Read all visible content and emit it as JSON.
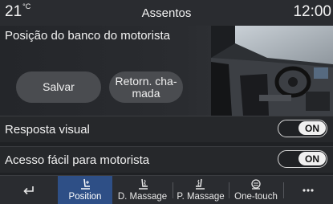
{
  "status_bar": {
    "temperature": "21",
    "temperature_unit": "°C",
    "title": "Assentos",
    "time": "12:00"
  },
  "seat_panel": {
    "title": "Posição do banco do motorista",
    "save_label": "Salvar",
    "recall_label_line1": "Retorn. cha-",
    "recall_label_line2": "mada"
  },
  "settings": [
    {
      "label": "Resposta visual",
      "state": "ON"
    },
    {
      "label": "Acesso fácil para motorista",
      "state": "ON"
    }
  ],
  "tabs": [
    {
      "label": "",
      "icon": "back-arrow-icon"
    },
    {
      "label": "Position",
      "icon": "seat-position-icon",
      "active": true
    },
    {
      "label": "D. Massage",
      "icon": "driver-massage-icon"
    },
    {
      "label": "P. Massage",
      "icon": "passenger-massage-icon"
    },
    {
      "label": "One-touch",
      "icon": "one-touch-icon"
    },
    {
      "label": "",
      "icon": "more-icon"
    }
  ],
  "colors": {
    "background": "#1f2124",
    "active_tab": "#2e4f86",
    "button": "#4a4c50"
  }
}
